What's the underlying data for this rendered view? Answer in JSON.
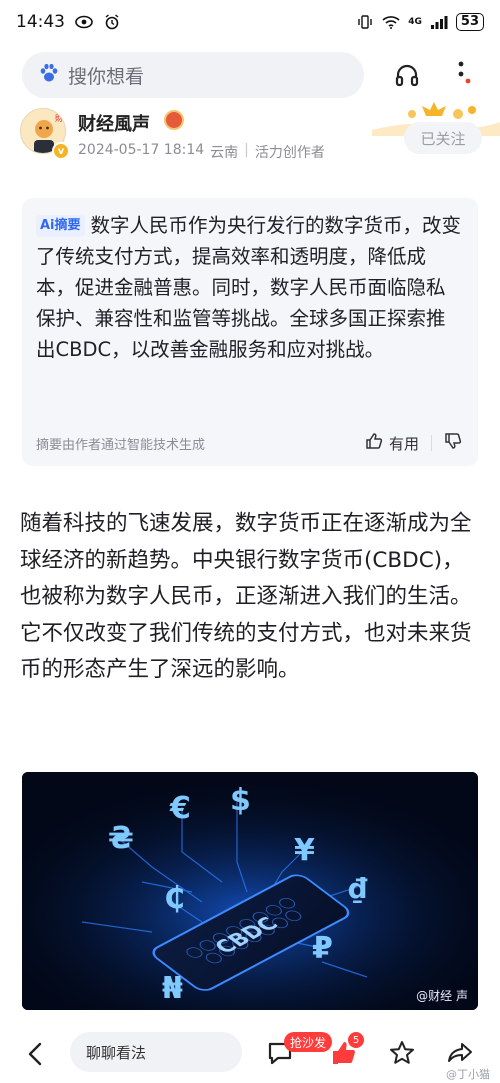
{
  "status_bar": {
    "time": "14:43",
    "battery": "53",
    "network": "4G"
  },
  "search": {
    "placeholder": "搜你想看"
  },
  "author": {
    "name": "财经風声",
    "date": "2024-05-17 18:14",
    "location": "云南",
    "role": "活力创作者",
    "follow_label": "已关注"
  },
  "summary": {
    "tag": "Ai摘要",
    "text": "数字人民币作为央行发行的数字货币，改变了传统支付方式，提高效率和透明度，降低成本，促进金融普惠。同时，数字人民币面临隐私保护、兼容性和监管等挑战。全球多国正探索推出CBDC，以改善金融服务和应对挑战。",
    "note": "摘要由作者通过智能技术生成",
    "useful_label": "有用"
  },
  "article": {
    "paragraph": "随着科技的飞速发展，数字货币正在逐渐成为全球经济的新趋势。中央银行数字货币(CBDC)，也被称为数字人民币，正逐渐进入我们的生活。它不仅改变了我们传统的支付方式，也对未来货币的形态产生了深远的影响。"
  },
  "image": {
    "phone_text": "CBDC",
    "credit": "@财经  声",
    "symbols": [
      "€",
      "$",
      "₴",
      "¥",
      "₵",
      "₫",
      "₽",
      "₦"
    ]
  },
  "bottom_bar": {
    "comment_placeholder": "聊聊看法",
    "sofa_label": "抢沙发",
    "like_count": "5",
    "watermark": "@丁小猫"
  },
  "colors": {
    "accent_blue": "#3168f0",
    "badge_red": "#ff3c3c",
    "neon_blue": "#4fb6ff"
  }
}
